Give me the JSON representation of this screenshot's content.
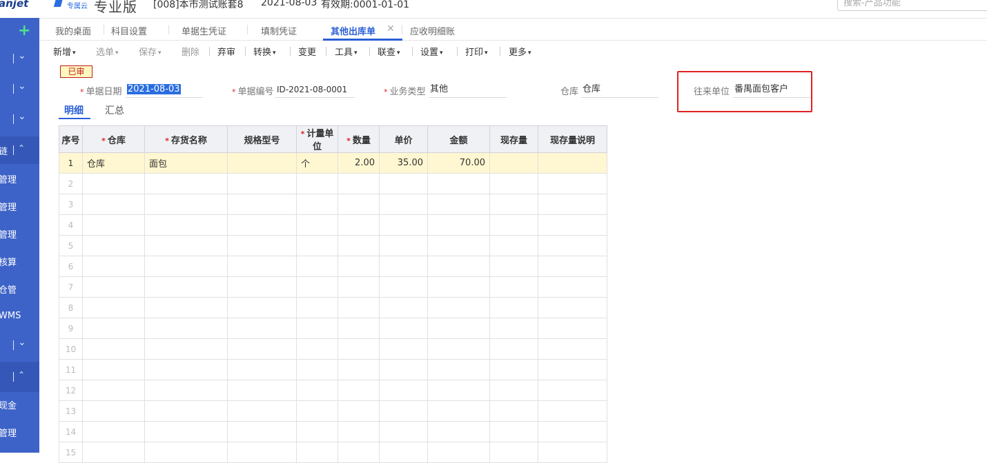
{
  "header": {
    "brand_left": "anjet",
    "brand_sub": "专属云",
    "edition": "专业版",
    "account": "[008]本市测试账套8",
    "date": "2021-08-03",
    "valid": "有效期:0001-01-01",
    "search_placeholder": "搜索-产品功能"
  },
  "sidebar": {
    "items": [
      "链",
      "管理",
      "管理",
      "管理",
      "核算",
      "仓管",
      "WMS",
      "现金",
      "管理"
    ]
  },
  "tabs": [
    {
      "label": "我的桌面"
    },
    {
      "label": "科目设置"
    },
    {
      "label": "单据生凭证"
    },
    {
      "label": "填制凭证"
    },
    {
      "label": "其他出库单"
    },
    {
      "label": "应收明细账"
    }
  ],
  "toolbar": {
    "new": "新增",
    "select": "选单",
    "save": "保存",
    "delete": "删除",
    "abandon": "弃审",
    "convert": "转换",
    "change": "变更",
    "tools": "工具",
    "linked": "联查",
    "settings": "设置",
    "print": "打印",
    "more": "更多"
  },
  "status": "已审",
  "form": {
    "date_label": "单据日期",
    "date_value": "2021-08-03",
    "number_label": "单据编号",
    "number_value": "ID-2021-08-0001",
    "biz_label": "业务类型",
    "biz_value": "其他",
    "warehouse_label": "仓库",
    "warehouse_value": "仓库",
    "partner_label": "往来单位",
    "partner_value": "番禺面包客户"
  },
  "subtabs": {
    "detail": "明细",
    "summary": "汇总"
  },
  "table": {
    "headers": [
      "序号",
      "仓库",
      "存货名称",
      "规格型号",
      "计量单位",
      "数量",
      "单价",
      "金额",
      "现存量",
      "现存量说明"
    ],
    "rows": [
      [
        "1",
        "仓库",
        "面包",
        "",
        "个",
        "2.00",
        "35.00",
        "70.00",
        "",
        ""
      ],
      [
        "2",
        "",
        "",
        "",
        "",
        "",
        "",
        "",
        "",
        ""
      ],
      [
        "3",
        "",
        "",
        "",
        "",
        "",
        "",
        "",
        "",
        ""
      ],
      [
        "4",
        "",
        "",
        "",
        "",
        "",
        "",
        "",
        "",
        ""
      ],
      [
        "5",
        "",
        "",
        "",
        "",
        "",
        "",
        "",
        "",
        ""
      ],
      [
        "6",
        "",
        "",
        "",
        "",
        "",
        "",
        "",
        "",
        ""
      ],
      [
        "7",
        "",
        "",
        "",
        "",
        "",
        "",
        "",
        "",
        ""
      ],
      [
        "8",
        "",
        "",
        "",
        "",
        "",
        "",
        "",
        "",
        ""
      ],
      [
        "9",
        "",
        "",
        "",
        "",
        "",
        "",
        "",
        "",
        ""
      ],
      [
        "10",
        "",
        "",
        "",
        "",
        "",
        "",
        "",
        "",
        ""
      ],
      [
        "11",
        "",
        "",
        "",
        "",
        "",
        "",
        "",
        "",
        ""
      ],
      [
        "12",
        "",
        "",
        "",
        "",
        "",
        "",
        "",
        "",
        ""
      ],
      [
        "13",
        "",
        "",
        "",
        "",
        "",
        "",
        "",
        "",
        ""
      ],
      [
        "14",
        "",
        "",
        "",
        "",
        "",
        "",
        "",
        "",
        ""
      ],
      [
        "15",
        "",
        "",
        "",
        "",
        "",
        "",
        "",
        "",
        ""
      ]
    ]
  }
}
